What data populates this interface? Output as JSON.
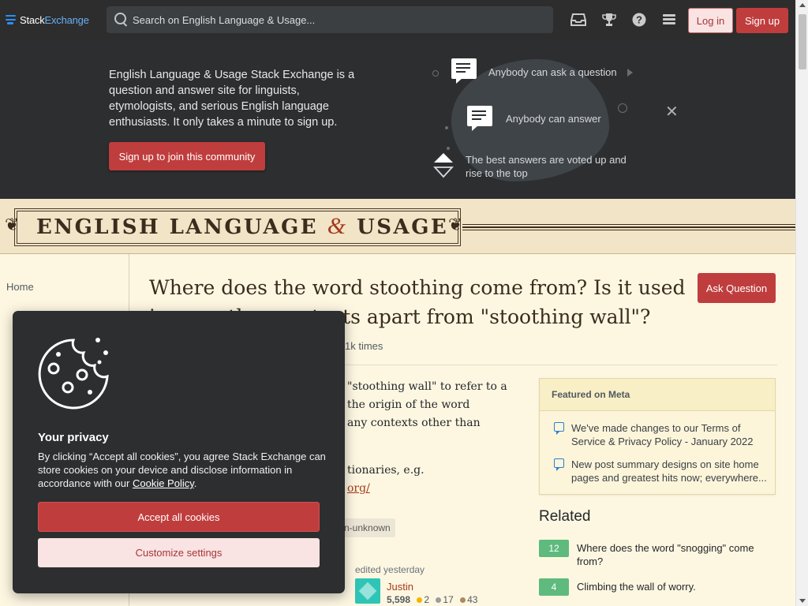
{
  "header": {
    "logo_stack": "Stack",
    "logo_exchange": "Exchange",
    "search_placeholder": "Search on English Language & Usage...",
    "login_label": "Log in",
    "signup_label": "Sign up",
    "icons": [
      "inbox-icon",
      "trophy-icon",
      "help-icon",
      "site-switcher-icon"
    ]
  },
  "hero": {
    "description": "English Language & Usage Stack Exchange is a question and answer site for linguists, etymologists, and serious English language enthusiasts. It only takes a minute to sign up.",
    "join_label": "Sign up to join this community",
    "item_ask": "Anybody can ask a question",
    "item_answer": "Anybody can answer",
    "item_vote": "The best answers are voted up and rise to the top",
    "close_symbol": "✕"
  },
  "banner": {
    "title_left": "ENGLISH LANGUAGE",
    "amp": "&",
    "title_right": "USAGE"
  },
  "sidebar": {
    "home_label": "Home"
  },
  "question": {
    "title": "Where does the word stoothing come from? Is it used in any other contexts apart from \"stoothing wall\"?",
    "ask_label": "Ask Question",
    "viewed": "1k times",
    "body_line1": "\"stoothing wall\" to refer to a",
    "body_line2": "the origin of the word",
    "body_line3": "any contexts other than",
    "body_line4": "tionaries, e.g.",
    "body_link": "org/",
    "tag": "n-unknown",
    "edited_label": "edited yesterday",
    "user_name": "Justin",
    "user_rep": "5,598",
    "badges": {
      "gold": "2",
      "silver": "17",
      "bronze": "43"
    }
  },
  "featured": {
    "title": "Featured on Meta",
    "items": [
      "We've made changes to our Terms of Service & Privacy Policy - January 2022",
      "New post summary designs on site home pages and greatest hits now; everywhere..."
    ]
  },
  "related": {
    "title": "Related",
    "items": [
      {
        "count": "12",
        "text": "Where does the word \"snogging\" come from?"
      },
      {
        "count": "4",
        "text": "Climbing the wall of worry."
      }
    ]
  },
  "cookie": {
    "title": "Your privacy",
    "text": "By clicking “Accept all cookies”, you agree Stack Exchange can store cookies on your device and disclose information in accordance with our",
    "link": "Cookie Policy",
    "period": ".",
    "accept_label": "Accept all cookies",
    "customize_label": "Customize settings"
  },
  "colors": {
    "brand_red": "#c03d3d",
    "header_bg": "#2d2d2d",
    "page_bg": "#fdf7e2",
    "answered_green": "#5eba7d",
    "link_blue": "#66b0f7"
  }
}
